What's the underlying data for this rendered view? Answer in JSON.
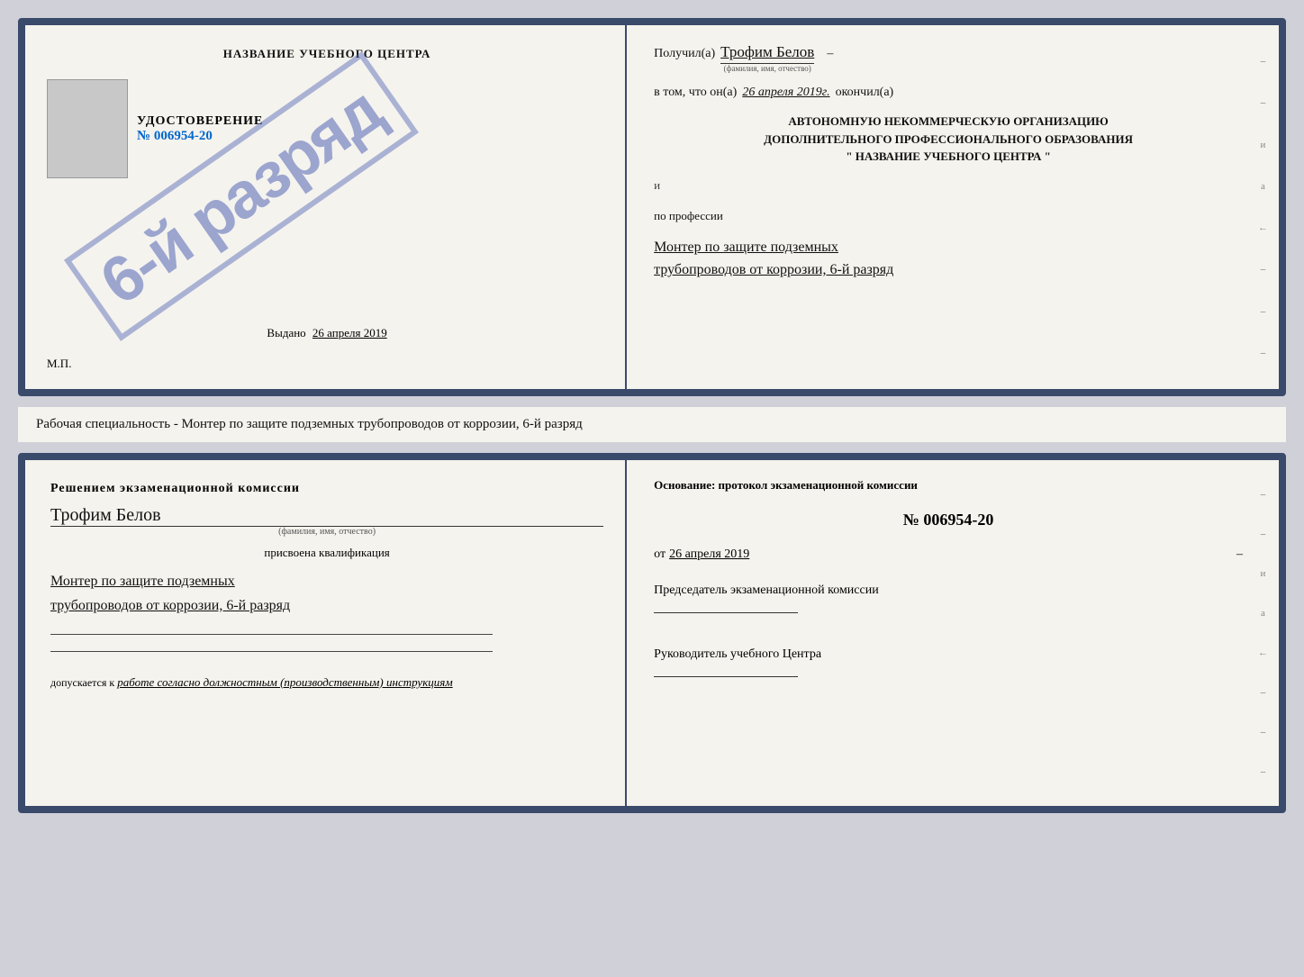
{
  "top_cert": {
    "left": {
      "title": "НАЗВАНИЕ УЧЕБНОГО ЦЕНТРА",
      "stamp_text": "6-й разряд",
      "udostoverenie_label": "УДОСТОВЕРЕНИЕ",
      "number": "№ 006954-20",
      "vydano_label": "Выдано",
      "vydano_date": "26 апреля 2019",
      "mp_label": "М.П."
    },
    "right": {
      "poluchil_label": "Получил(а)",
      "poluchil_name": "Трофим Белов",
      "fio_hint": "(фамилия, имя, отчество)",
      "dash1": "–",
      "vtom_label": "в том, что он(а)",
      "date_value": "26 апреля 2019г.",
      "okonchil_label": "окончил(а)",
      "org_line1": "АВТОНОМНУЮ НЕКОММЕРЧЕСКУЮ ОРГАНИЗАЦИЮ",
      "org_line2": "ДОПОЛНИТЕЛЬНОГО ПРОФЕССИОНАЛЬНОГО ОБРАЗОВАНИЯ",
      "org_line3": "\"   НАЗВАНИЕ УЧЕБНОГО ЦЕНТРА   \"",
      "i_label": "и",
      "po_professii_label": "по профессии",
      "profession_line1": "Монтер по защите подземных",
      "profession_line2": "трубопроводов от коррозии, 6-й разряд"
    }
  },
  "middle_text": "Рабочая специальность - Монтер по защите подземных трубопроводов от коррозии, 6-й разряд",
  "bottom_cert": {
    "left": {
      "reshenie_label": "Решением экзаменационной комиссии",
      "fio_value": "Трофим Белов",
      "fio_hint": "(фамилия, имя, отчество)",
      "prisvoena_label": "присвоена квалификация",
      "qualification_line1": "Монтер по защите подземных",
      "qualification_line2": "трубопроводов от коррозии, 6-й разряд",
      "dopuskaetsya_label": "допускается к",
      "dopusk_value": "работе согласно должностным (производственным) инструкциям"
    },
    "right": {
      "osnovanie_label": "Основание: протокол экзаменационной комиссии",
      "number_value": "№  006954-20",
      "ot_label": "от",
      "ot_date": "26 апреля 2019",
      "predsedatel_label": "Председатель экзаменационной комиссии",
      "rukovoditel_label": "Руководитель учебного Центра"
    }
  }
}
